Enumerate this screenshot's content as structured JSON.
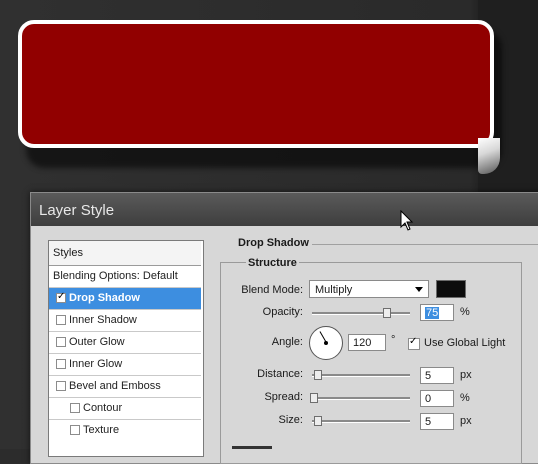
{
  "dialog": {
    "title": "Layer Style"
  },
  "style_list": {
    "header": "Styles",
    "items": [
      {
        "label": "Blending Options: Default",
        "checkbox": false,
        "checked": false,
        "selected": false,
        "indent": 0
      },
      {
        "label": "Drop Shadow",
        "checkbox": true,
        "checked": true,
        "selected": true,
        "indent": 0
      },
      {
        "label": "Inner Shadow",
        "checkbox": true,
        "checked": false,
        "selected": false,
        "indent": 0
      },
      {
        "label": "Outer Glow",
        "checkbox": true,
        "checked": false,
        "selected": false,
        "indent": 0
      },
      {
        "label": "Inner Glow",
        "checkbox": true,
        "checked": false,
        "selected": false,
        "indent": 0
      },
      {
        "label": "Bevel and Emboss",
        "checkbox": true,
        "checked": false,
        "selected": false,
        "indent": 0
      },
      {
        "label": "Contour",
        "checkbox": true,
        "checked": false,
        "selected": false,
        "indent": 1
      },
      {
        "label": "Texture",
        "checkbox": true,
        "checked": false,
        "selected": false,
        "indent": 1
      }
    ]
  },
  "drop_shadow": {
    "section_title": "Drop Shadow",
    "structure_title": "Structure",
    "blend_mode_label": "Blend Mode:",
    "blend_mode_value": "Multiply",
    "shadow_color": "#0c0c0c",
    "opacity_label": "Opacity:",
    "opacity_value": "75",
    "opacity_unit": "%",
    "opacity_fraction": 0.75,
    "angle_label": "Angle:",
    "angle_value": "120",
    "angle_unit": "°",
    "use_global_light_label": "Use Global Light",
    "use_global_light_checked": true,
    "distance_label": "Distance:",
    "distance_value": "5",
    "distance_unit": "px",
    "spread_label": "Spread:",
    "spread_value": "0",
    "spread_unit": "%",
    "size_label": "Size:",
    "size_value": "5",
    "size_unit": "px"
  },
  "colors": {
    "banner_red": "#910000",
    "selection_blue": "#3d8ee0"
  }
}
